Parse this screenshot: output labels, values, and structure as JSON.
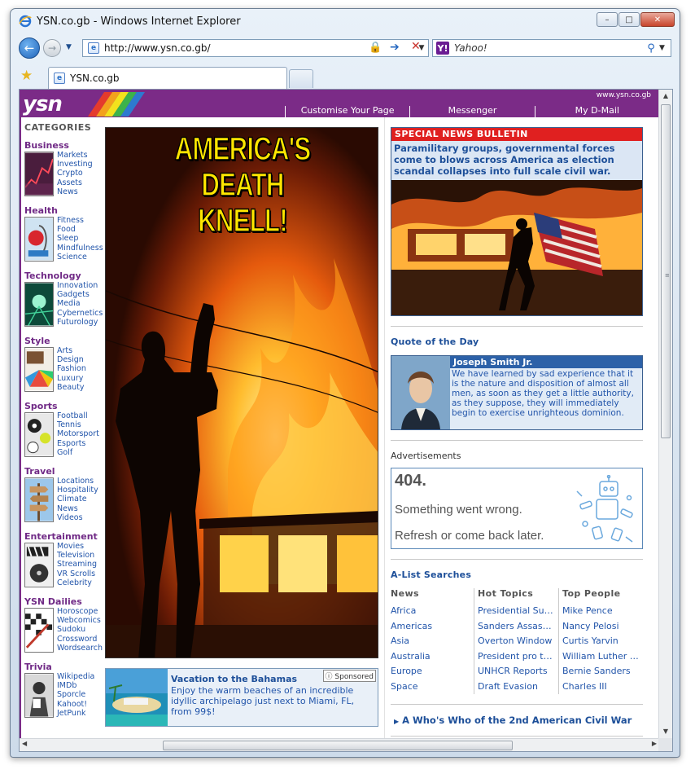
{
  "window": {
    "title": "YSN.co.gb - Windows Internet Explorer",
    "address": "http://www.ysn.co.gb/",
    "search_placeholder": "Yahoo!",
    "tab_title": "YSN.co.gb"
  },
  "header": {
    "logo_text": "ysn",
    "domain": "www.ysn.co.gb",
    "links": [
      "Customise Your Page",
      "Messenger",
      "My D-Mail"
    ]
  },
  "sidebar": {
    "title": "CATEGORIES",
    "categories": [
      {
        "name": "Business",
        "links": [
          "Markets",
          "Investing",
          "Crypto",
          "Assets",
          "News"
        ]
      },
      {
        "name": "Health",
        "links": [
          "Fitness",
          "Food",
          "Sleep",
          "Mindfulness",
          "Science"
        ]
      },
      {
        "name": "Technology",
        "links": [
          "Innovation",
          "Gadgets",
          "Media",
          "Cybernetics",
          "Futurology"
        ]
      },
      {
        "name": "Style",
        "links": [
          "Arts",
          "Design",
          "Fashion",
          "Luxury",
          "Beauty"
        ]
      },
      {
        "name": "Sports",
        "links": [
          "Football",
          "Tennis",
          "Motorsport",
          "Esports",
          "Golf"
        ]
      },
      {
        "name": "Travel",
        "links": [
          "Locations",
          "Hospitality",
          "Climate",
          "News",
          "Videos"
        ]
      },
      {
        "name": "Entertainment",
        "links": [
          "Movies",
          "Television",
          "Streaming",
          "VR Scrolls",
          "Celebrity"
        ]
      },
      {
        "name": "YSN Dailies",
        "links": [
          "Horoscope",
          "Webcomics",
          "Sudoku",
          "Crossword",
          "Wordsearch"
        ]
      },
      {
        "name": "Trivia",
        "links": [
          "Wikipedia",
          "IMDb",
          "Sporcle",
          "Kahoot!",
          "JetPunk"
        ]
      }
    ]
  },
  "hero": {
    "headline_line1": "AMERICA'S DEATH",
    "headline_line2": "KNELL!"
  },
  "promo": {
    "title": "Vacation to the Bahamas",
    "badge": "Sponsored",
    "body": "Enjoy the warm beaches of an incredible idyllic archipelago just next to Miami, FL, from 99$!"
  },
  "bulletin": {
    "heading": "SPECIAL NEWS BULLETIN",
    "text": "Paramilitary groups, governmental forces come to blows across America as election scandal collapses into full scale civil war."
  },
  "quote": {
    "section_title": "Quote of the Day",
    "name": "Joseph Smith Jr.",
    "text": "We have learned by sad experience that it is the nature and disposition of almost all men, as soon as they get a little authority, as they suppose, they will immediately begin to exercise unrighteous dominion."
  },
  "ads": {
    "title": "Advertisements",
    "code": "404.",
    "line1": "Something went wrong.",
    "line2": "Refresh or come back later."
  },
  "alist": {
    "title": "A-List Searches",
    "columns": [
      {
        "head": "News",
        "items": [
          "Africa",
          "Americas",
          "Asia",
          "Australia",
          "Europe",
          "Space"
        ]
      },
      {
        "head": "Hot Topics",
        "items": [
          "Presidential Suc...",
          "Sanders Assassin",
          "Overton Window",
          "President pro te...",
          "UNHCR Reports",
          "Draft Evasion"
        ]
      },
      {
        "head": "Top People",
        "items": [
          "Mike Pence",
          "Nancy Pelosi",
          "Curtis Yarvin",
          "William Luther Pi...",
          "Bernie Sanders",
          "Charles III"
        ]
      }
    ],
    "footer_link": "A Who's Who of the 2nd American Civil War"
  }
}
